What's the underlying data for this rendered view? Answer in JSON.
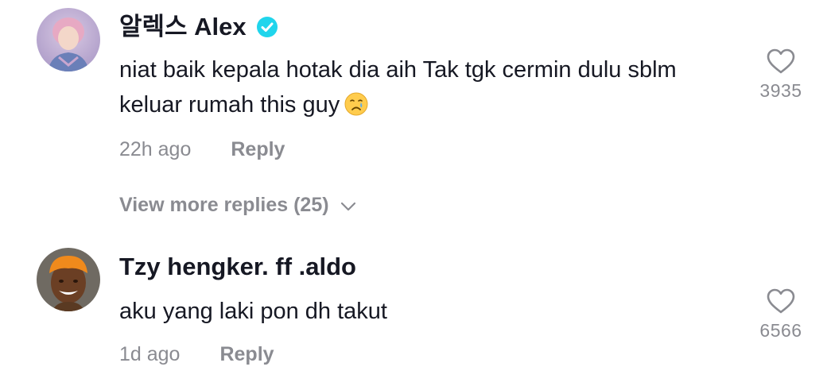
{
  "comments": [
    {
      "username": "알렉스 Alex",
      "verified": true,
      "text_line1": "niat baik kepala hotak dia aih Tak tgk cermin dulu sblm",
      "text_line2": "keluar rumah this guy",
      "emoji": "crying-face-emoji",
      "time": "22h ago",
      "reply_label": "Reply",
      "likes": "3935",
      "view_more": "View more replies (25)"
    },
    {
      "username": "Tzy hengker. ff .aldo",
      "verified": false,
      "text": "aku yang laki pon dh takut",
      "time": "1d ago",
      "reply_label": "Reply",
      "likes": "6566"
    }
  ],
  "colors": {
    "text": "#161823",
    "muted": "#8a8b91",
    "verified_badge": "#20d5ec"
  },
  "icons": {
    "like": "heart-outline-icon",
    "verified": "verified-badge-icon",
    "expand": "chevron-down-icon"
  }
}
